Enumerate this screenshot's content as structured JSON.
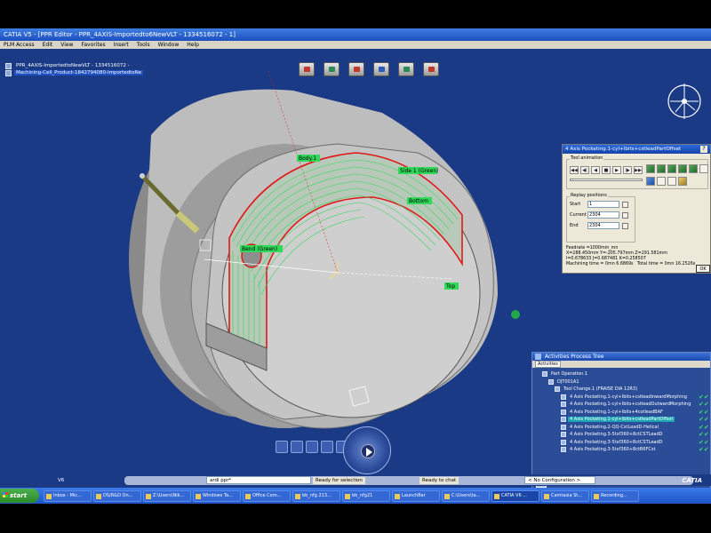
{
  "window": {
    "title": "CATIA V5 - [PPR Editor - PPR_4AXIS-Importedto6NewVLT - 1334516072 - 1]"
  },
  "menu": [
    "PLM Access",
    "Edit",
    "View",
    "Favorites",
    "Insert",
    "Tools",
    "Window",
    "Help"
  ],
  "spec_tree": {
    "root": "PPR_4AXIS-ImportedtoNewVLT - 1334516072 -",
    "child": "Machining-Cell_Product-1842794080-ImportedtoNe"
  },
  "labels_3d": {
    "body": "Body.1",
    "side": "Side 1 (Green)",
    "bottom": "Bottom",
    "top": "Top",
    "bend": "Bend (Green)"
  },
  "tool_dialog": {
    "title": "4 Axis Pocketing.1-cyl+Ibits+cstleadPartOffset",
    "group_animation": "Tool animation",
    "group_replay": "Replay positions",
    "start_label": "Start",
    "start_value": "1",
    "current_label": "Current",
    "current_value": "2304",
    "end_label": "End",
    "end_value": "2304",
    "feedrate": "Feedrate =1000mm_mn",
    "coords": "X=288.450mm Y=-205.797mm Z=291.581mm",
    "ijk": "I=0.678633 J=0.687481 K=0.258507",
    "machining_time": "Machining time = 0mn 6.6869s",
    "total_time": "Total time = 0mn 16.2526s",
    "ok": "OK",
    "help": "?"
  },
  "process_tree": {
    "title": "Activities Process Tree",
    "filter": "Activities",
    "rows": [
      {
        "label": "Part Operation.1",
        "indent": 1,
        "check": false,
        "selected": false
      },
      {
        "label": "DJT001A1",
        "indent": 2,
        "check": false,
        "selected": false
      },
      {
        "label": "Tool Change.1 (FRAISE DIA 12R3)",
        "indent": 3,
        "check": false,
        "selected": false
      },
      {
        "label": "4 Axis Pocketing.1-cyl+Ibits+cstleadInwardMorphing",
        "indent": 4,
        "check": true,
        "selected": false
      },
      {
        "label": "4 Axis Pocketing.1-cyl+Ibits+cstleadOutwardMorphing",
        "indent": 4,
        "check": true,
        "selected": false
      },
      {
        "label": "4 Axis Pocketing.1-cyl+Ibits+4cotleadBAF",
        "indent": 4,
        "check": true,
        "selected": false
      },
      {
        "label": "4 Axis Pocketing.1-cyl+Ibits+cstleadPartOffset",
        "indent": 4,
        "check": true,
        "selected": true
      },
      {
        "label": "4 Axis Pocketing.2-QQ-CstLeadD-Helical",
        "indent": 4,
        "check": true,
        "selected": false
      },
      {
        "label": "4 Axis Pocketing.3-5txf360+8ctCSTLeadD",
        "indent": 4,
        "check": true,
        "selected": false
      },
      {
        "label": "4 Axis Pocketing.3-5txf360+8ctCSTLeadD",
        "indent": 4,
        "check": true,
        "selected": false
      },
      {
        "label": "4 Axis Pocketing.3-5txf360+8ctB6FCst",
        "indent": 4,
        "check": true,
        "selected": false
      }
    ]
  },
  "status_bar": {
    "command_value": "ardi ppr*",
    "ready_selection": "Ready for selection",
    "ready_chat": "Ready to chat",
    "config": "< No Configuration >",
    "brand": "CATIA",
    "left_label": "V6"
  },
  "taskbar": {
    "start": "start",
    "items": [
      "Inbox - Mic...",
      "DS/R&D On...",
      "Z:\\Users\\Nik...",
      "Windows Ta...",
      "Office Com...",
      "bb_nfg 213...",
      "bb_nfg21",
      "LaunchBar",
      "C:\\Users\\ta...",
      "CATIA V6 ...",
      "Camtasia St...",
      "Recording..."
    ]
  },
  "colors": {
    "background": "#1b3a86",
    "part_body": "#a8a8a8",
    "toolpath": "#31d85a",
    "boundary": "#e01818",
    "selection": "#1aa4b4"
  }
}
